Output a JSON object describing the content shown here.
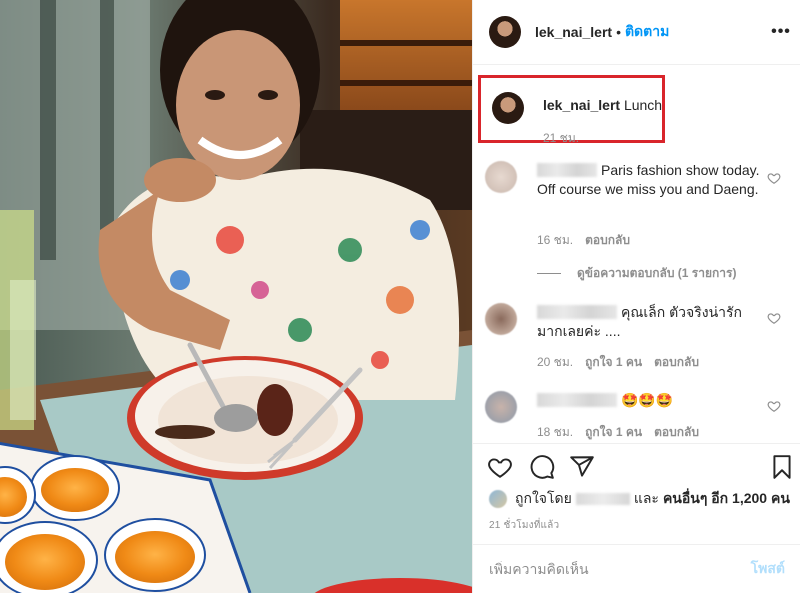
{
  "post": {
    "username": "lek_nai_lert",
    "separator": "•",
    "follow_label": "ติดตาม",
    "more_label": "•••"
  },
  "caption": {
    "username": "lek_nai_lert",
    "text": "Lunch",
    "time": "21 ชม."
  },
  "comments": [
    {
      "text": "Paris fashion show today. Off course we miss you and Daeng.",
      "time": "16 ชม.",
      "reply_label": "ตอบกลับ",
      "likes": ""
    },
    {
      "text": "คุณเล็ก ตัวจริงน่ารักมากเลยค่ะ ....",
      "time": "20 ชม.",
      "likes": "ถูกใจ 1 คน",
      "reply_label": "ตอบกลับ"
    },
    {
      "text": "🤩🤩🤩",
      "time": "18 ชม.",
      "likes": "ถูกใจ 1 คน",
      "reply_label": "ตอบกลับ"
    }
  ],
  "view_replies": "ดูข้อความตอบกลับ (1 รายการ)",
  "likes_summary": {
    "prefix": "ถูกใจโดย",
    "middle": "และ",
    "others": "คนอื่นๆ อีก 1,200 คน"
  },
  "posted_ago": "21 ชั่วโมงที่แล้ว",
  "comment_box": {
    "placeholder": "เพิ่มความคิดเห็น",
    "post_label": "โพสต์"
  },
  "icons": {
    "like": "heart-icon",
    "comment": "comment-icon",
    "share": "share-icon",
    "save": "bookmark-icon",
    "more": "more-options-icon"
  },
  "colors": {
    "link": "#0095f6",
    "highlight_box": "#d9252b",
    "muted_text": "#8e8e8e",
    "post_disabled": "#b2dffc"
  }
}
